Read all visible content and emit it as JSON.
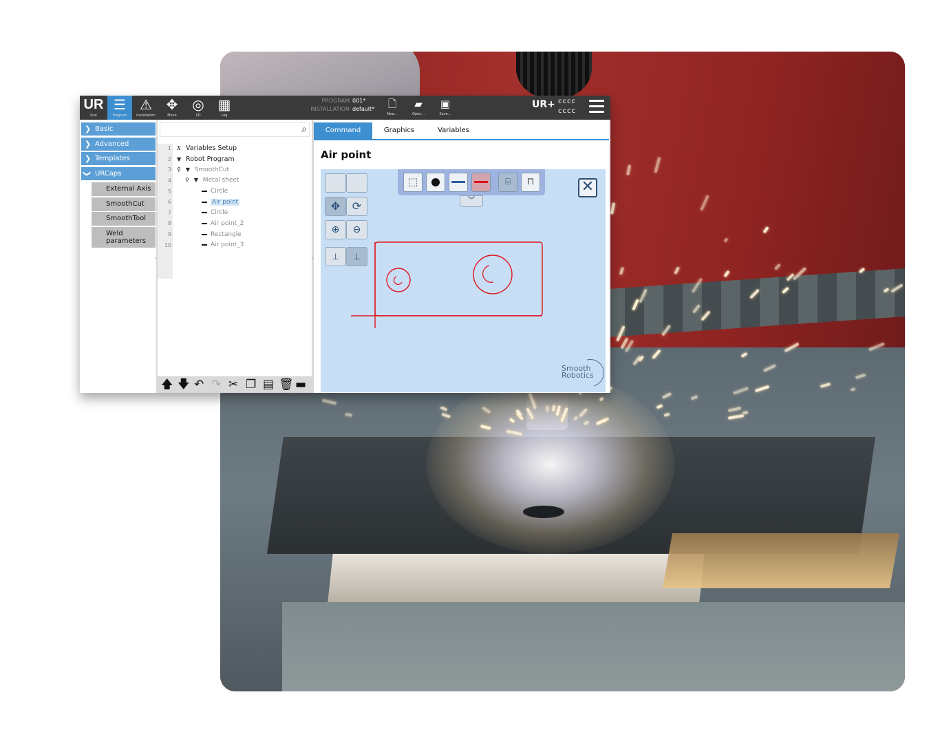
{
  "topbar": {
    "nav_buttons": [
      {
        "label": "Run",
        "icon": "ur-logo-icon"
      },
      {
        "label": "Program",
        "icon": "program-icon"
      },
      {
        "label": "Installation",
        "icon": "installation-icon"
      },
      {
        "label": "Move",
        "icon": "move-arrows-icon"
      },
      {
        "label": "I/O",
        "icon": "io-icon"
      },
      {
        "label": "Log",
        "icon": "log-icon"
      }
    ],
    "program_key": "PROGRAM",
    "program_value": "001*",
    "installation_key": "INSTALLATION",
    "installation_value": "default*",
    "file_buttons": [
      {
        "label": "New...",
        "icon": "new-file-icon"
      },
      {
        "label": "Open...",
        "icon": "open-folder-icon"
      },
      {
        "label": "Save...",
        "icon": "save-disk-icon"
      }
    ],
    "brand": "UR+",
    "status_line1": "cccc",
    "status_line2": "cccc"
  },
  "nav": {
    "items": [
      {
        "label": "Basic",
        "expanded": false
      },
      {
        "label": "Advanced",
        "expanded": false
      },
      {
        "label": "Templates",
        "expanded": false
      },
      {
        "label": "URCaps",
        "expanded": true
      }
    ],
    "urcaps_children": [
      "External Axis",
      "SmoothCut",
      "SmoothTool",
      "Weld parameters"
    ]
  },
  "tree": {
    "search_placeholder": "",
    "lines": [
      {
        "num": "1",
        "label": "Variables Setup",
        "glyph": "X"
      },
      {
        "num": "2",
        "label": "Robot Program",
        "glyph": "▼"
      },
      {
        "num": "3",
        "label": "SmoothCut",
        "glyph": "▼"
      },
      {
        "num": "4",
        "label": "Metal sheet",
        "glyph": "▼"
      },
      {
        "num": "5",
        "label": "Circle",
        "glyph": "—"
      },
      {
        "num": "6",
        "label": "Air point",
        "glyph": "—",
        "selected": true
      },
      {
        "num": "7",
        "label": "Circle",
        "glyph": "—"
      },
      {
        "num": "8",
        "label": "Air point_2",
        "glyph": "—"
      },
      {
        "num": "9",
        "label": "Rectangle",
        "glyph": "—"
      },
      {
        "num": "10",
        "label": "Air point_3",
        "glyph": "—"
      }
    ],
    "toolbar_icons": [
      "move-up-icon",
      "move-down-icon",
      "undo-icon",
      "redo-icon",
      "cut-icon",
      "copy-icon",
      "paste-icon",
      "delete-icon",
      "suppress-icon"
    ]
  },
  "right": {
    "tabs": [
      "Command",
      "Graphics",
      "Variables"
    ],
    "active_tab": "Command",
    "title": "Air point",
    "brand_line1": "Smooth",
    "brand_line2": "Robotics"
  },
  "colors": {
    "accent": "#3d8fd0",
    "nav_blue": "#5b9fd6",
    "canvas_bg": "#c7def5",
    "path_red": "#e0141c",
    "topbar": "#3a3a3a"
  }
}
